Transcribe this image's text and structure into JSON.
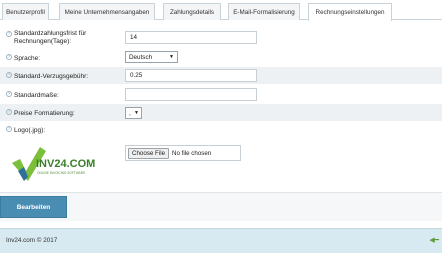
{
  "tabs": [
    {
      "label": "Benutzerprofil"
    },
    {
      "label": "Meine Unternehmensangaben"
    },
    {
      "label": "Zahlungsdetails"
    },
    {
      "label": "E-Mail-Formalisierung"
    },
    {
      "label": "Rechnungseinstellungen"
    }
  ],
  "active_tab": "Rechnungseinstellungen",
  "fields": {
    "payment_term": {
      "label_line1": "Standardzahlungsfrist für",
      "label_line2": "Rechnungen(Tage):",
      "value": "14"
    },
    "language": {
      "label": "Sprache:",
      "value": "Deutsch"
    },
    "late_fee": {
      "label": "Standard-Verzugsgebühr:",
      "value": "0.25"
    },
    "units": {
      "label": "Standardmaße:",
      "value": ""
    },
    "price_format": {
      "label": "Preise Formatierung:",
      "value": ","
    },
    "logo": {
      "label": "Logo(.jpg):"
    }
  },
  "logo_text": "INV24.COM",
  "logo_tagline": "ONLINE INVOICING SOFTWARE",
  "file_input": {
    "button": "Choose File",
    "status": "No file chosen"
  },
  "edit_button": "Bearbeiten",
  "footer": {
    "copyright": "Inv24.com © 2017"
  },
  "colors": {
    "accent": "#4a8db3",
    "footer_bg": "#d7e9f1",
    "logo_green": "#3a7d2a"
  }
}
